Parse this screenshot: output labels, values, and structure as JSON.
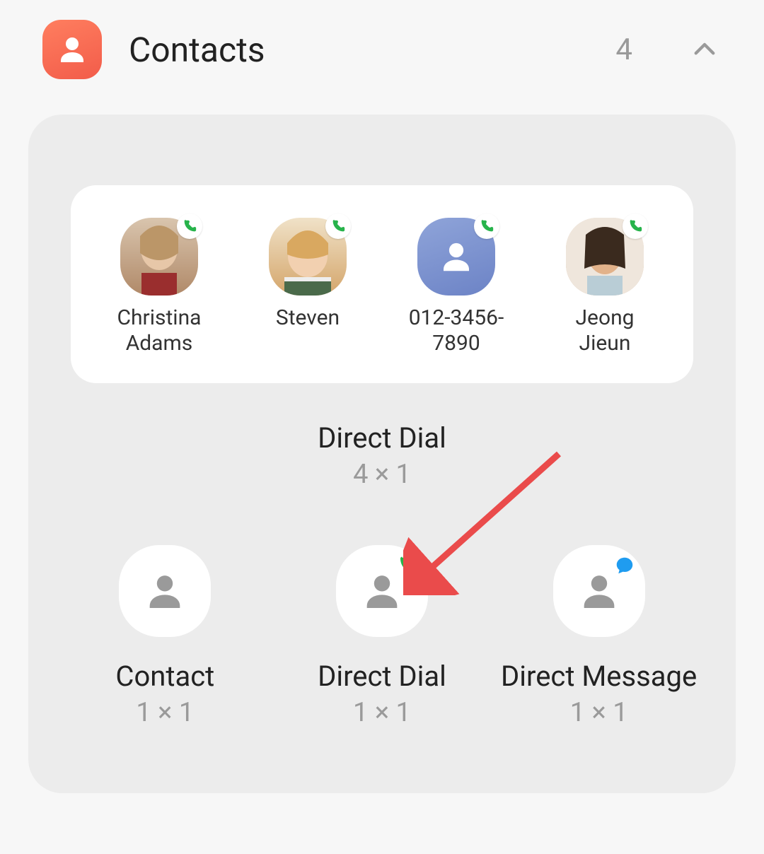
{
  "header": {
    "title": "Contacts",
    "count": "4"
  },
  "wide_widget": {
    "label": "Direct Dial",
    "dims": "4 × 1",
    "contacts": [
      {
        "name": "Christina\nAdams"
      },
      {
        "name": "Steven"
      },
      {
        "name": "012-3456-\n7890"
      },
      {
        "name": "Jeong\nJieun"
      }
    ]
  },
  "small_widgets": [
    {
      "label": "Contact",
      "dims": "1 × 1",
      "badge": "none"
    },
    {
      "label": "Direct Dial",
      "dims": "1 × 1",
      "badge": "phone"
    },
    {
      "label": "Direct Message",
      "dims": "1 × 1",
      "badge": "message"
    }
  ]
}
